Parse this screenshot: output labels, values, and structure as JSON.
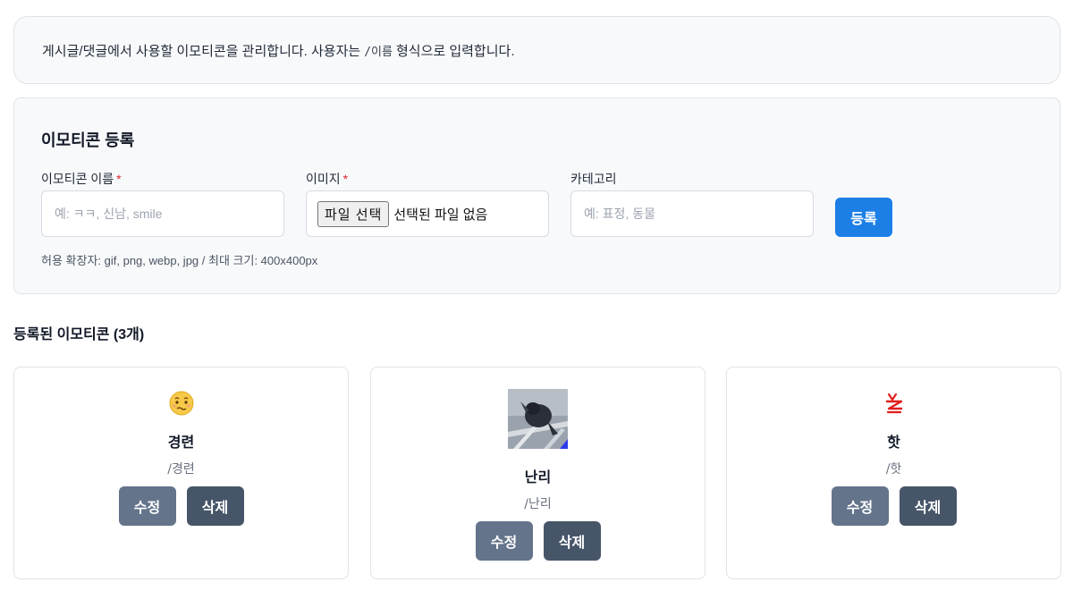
{
  "info": {
    "text_before": "게시글/댓글에서 사용할 이모티콘을 관리합니다. 사용자는",
    "code": "/이름",
    "text_after": "형식으로 입력합니다."
  },
  "form": {
    "title": "이모티콘 등록",
    "name_label": "이모티콘 이름",
    "name_placeholder": "예: ㅋㅋ, 신남, smile",
    "image_label": "이미지",
    "file_button": "파일 선택",
    "file_status": "선택된 파일 없음",
    "category_label": "카테고리",
    "category_placeholder": "예: 표정, 동물",
    "required_mark": "*",
    "submit_label": "등록",
    "hint": "허용 확장자: gif, png, webp, jpg / 최대 크기: 400x400px"
  },
  "list": {
    "title": "등록된 이모티콘 (3개)",
    "edit_label": "수정",
    "delete_label": "삭제",
    "items": [
      {
        "name": "경련",
        "code": "/경련",
        "icon": "twitching-face-emoji-icon"
      },
      {
        "name": "난리",
        "code": "/난리",
        "icon": "chaos-photo-thumbnail"
      },
      {
        "name": "핫",
        "code": "/핫",
        "icon": "red-hot-scribble-icon"
      }
    ]
  },
  "colors": {
    "primary": "#1b7fe6",
    "edit_button": "#64748b",
    "delete_button": "#475569",
    "required": "#dc2626"
  }
}
